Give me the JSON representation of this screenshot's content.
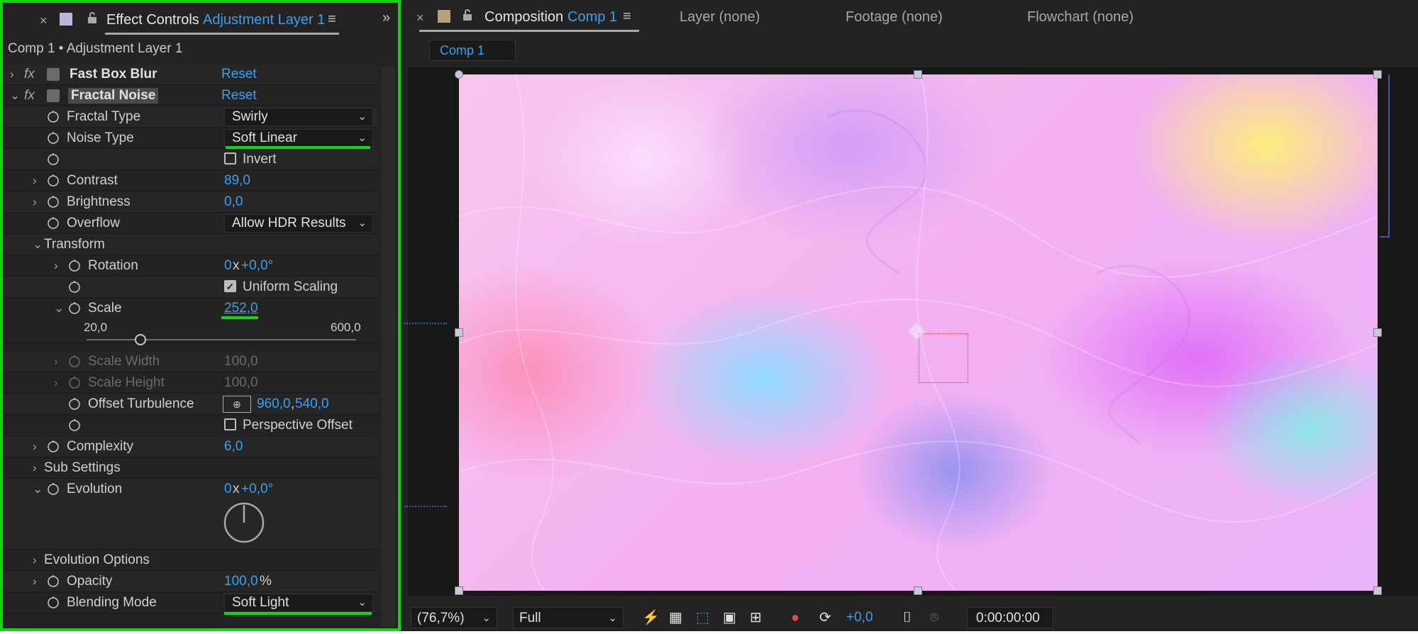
{
  "effect_controls": {
    "tab_label": "Effect Controls",
    "tab_layer": "Adjustment Layer 1",
    "subtitle": "Comp 1 • Adjustment Layer 1",
    "effects": [
      {
        "name": "Fast Box Blur",
        "reset": "Reset"
      },
      {
        "name": "Fractal Noise",
        "reset": "Reset"
      }
    ],
    "properties": {
      "fractal_type": {
        "label": "Fractal Type",
        "value": "Swirly"
      },
      "noise_type": {
        "label": "Noise Type",
        "value": "Soft Linear"
      },
      "invert": {
        "label": "Invert",
        "checked": false
      },
      "contrast": {
        "label": "Contrast",
        "value": "89,0"
      },
      "brightness": {
        "label": "Brightness",
        "value": "0,0"
      },
      "overflow": {
        "label": "Overflow",
        "value": "Allow HDR Results"
      },
      "transform": {
        "label": "Transform"
      },
      "rotation": {
        "label": "Rotation",
        "prefix": "0",
        "x": "x",
        "value": "+0,0°"
      },
      "uniform_scaling": {
        "label": "Uniform Scaling",
        "checked": true
      },
      "scale": {
        "label": "Scale",
        "value": "252,0",
        "min": "20,0",
        "max": "600,0",
        "slider_fraction": 0.2
      },
      "scale_width": {
        "label": "Scale Width",
        "value": "100,0"
      },
      "scale_height": {
        "label": "Scale Height",
        "value": "100,0"
      },
      "offset_turbulence": {
        "label": "Offset Turbulence",
        "x": "960,0",
        "y": "540,0"
      },
      "perspective_offset": {
        "label": "Perspective Offset",
        "checked": false
      },
      "complexity": {
        "label": "Complexity",
        "value": "6,0"
      },
      "sub_settings": {
        "label": "Sub Settings"
      },
      "evolution": {
        "label": "Evolution",
        "prefix": "0",
        "x": "x",
        "value": "+0,0°"
      },
      "evolution_options": {
        "label": "Evolution Options"
      },
      "opacity": {
        "label": "Opacity",
        "value": "100,0",
        "unit": "%"
      },
      "blending_mode": {
        "label": "Blending Mode",
        "value": "Soft Light"
      }
    }
  },
  "composition": {
    "tab_label": "Composition",
    "tab_comp": "Comp 1",
    "other_tabs": [
      "Layer (none)",
      "Footage (none)",
      "Flowchart (none)"
    ],
    "comp_tab": "Comp 1"
  },
  "viewer_bar": {
    "zoom": "(76,7%)",
    "resolution": "Full",
    "exposure": "+0,0",
    "timecode": "0:00:00:00"
  },
  "colors": {
    "accent": "#3aa0f0",
    "highlight": "#17d417"
  }
}
